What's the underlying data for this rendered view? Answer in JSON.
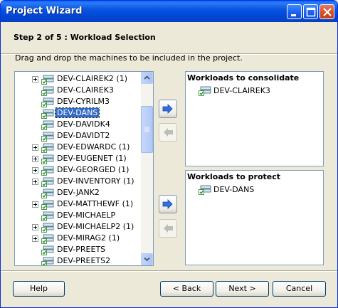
{
  "window": {
    "title": "Project Wizard"
  },
  "header": {
    "step_title": "Step 2 of 5 : Workload Selection",
    "instructions": "Drag and drop the machines to be included in the project."
  },
  "tree": {
    "items": [
      {
        "label": "DEV-CLAIREK2 (1)",
        "expandable": true,
        "selected": false
      },
      {
        "label": "DEV-CLAIREK3",
        "expandable": false,
        "selected": false
      },
      {
        "label": "DEV-CYRILM3",
        "expandable": false,
        "selected": false
      },
      {
        "label": "DEV-DANS",
        "expandable": false,
        "selected": true
      },
      {
        "label": "DEV-DAVIDK4",
        "expandable": false,
        "selected": false
      },
      {
        "label": "DEV-DAVIDT2",
        "expandable": false,
        "selected": false
      },
      {
        "label": "DEV-EDWARDC (1)",
        "expandable": true,
        "selected": false
      },
      {
        "label": "DEV-EUGENET (1)",
        "expandable": true,
        "selected": false
      },
      {
        "label": "DEV-GEORGED (1)",
        "expandable": true,
        "selected": false
      },
      {
        "label": "DEV-INVENTORY (1)",
        "expandable": true,
        "selected": false
      },
      {
        "label": "DEV-JANK2",
        "expandable": false,
        "selected": false
      },
      {
        "label": "DEV-MATTHEWF (1)",
        "expandable": true,
        "selected": false
      },
      {
        "label": "DEV-MICHAELP",
        "expandable": false,
        "selected": false
      },
      {
        "label": "DEV-MICHAELP2 (1)",
        "expandable": true,
        "selected": false
      },
      {
        "label": "DEV-MIRAG2 (1)",
        "expandable": true,
        "selected": false
      },
      {
        "label": "DEV-PREETS",
        "expandable": false,
        "selected": false
      },
      {
        "label": "DEV-PREETS2",
        "expandable": false,
        "selected": false
      }
    ]
  },
  "consolidate": {
    "title": "Workloads to consolidate",
    "items": [
      "DEV-CLAIREK3"
    ]
  },
  "protect": {
    "title": "Workloads to protect",
    "items": [
      "DEV-DANS"
    ]
  },
  "buttons": {
    "help": "Help",
    "back": "< Back",
    "next": "Next >",
    "cancel": "Cancel"
  },
  "icons": {
    "server": "server-check-icon",
    "arrow_right": "arrow-right-icon",
    "arrow_left": "arrow-left-icon"
  },
  "colors": {
    "titlebar": "#0b55e0",
    "selection": "#316ac5",
    "window_bg": "#ece9d8"
  }
}
